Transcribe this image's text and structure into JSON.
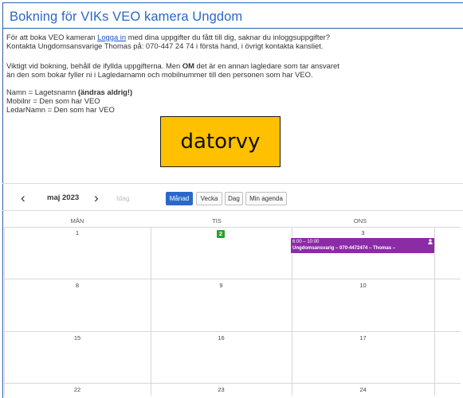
{
  "page": {
    "title": "Bokning för VIKs VEO kamera Ungdom",
    "intro_before_link": "För att boka VEO kameran ",
    "login_link": "Logga in",
    "intro_after_link": " med dina uppgifter du fått till dig, saknar du inloggsuppgifter?",
    "contact_line": "Kontakta Ungdomsansvarige Thomas på: 070-447 24 74 i första hand, i övrigt kontakta kansliet.",
    "important_before": "Viktigt vid bokning, behåll de ifyllda uppgifterna. Men ",
    "important_bold": "OM",
    "important_after": " det är en annan lagledare som tar ansvaret",
    "important_line2": "än den som bokar fyller ni i Lagledarnamn och mobilnummer till den personen som har VEO.",
    "name_rule_prefix": "Namn = Lagetsnamn ",
    "name_rule_bold": "(ändras aldrig!)",
    "mobile_rule": "Mobilnr = Den som har VEO",
    "leader_rule": "LedarNamn = Den som har VEO",
    "overlay_label": "datorvy"
  },
  "calendar": {
    "month_label": "maj 2023",
    "prev_icon": "‹",
    "next_icon": "›",
    "today_label": "Idag",
    "views": {
      "month": "Månad",
      "week": "Vecka",
      "day": "Dag",
      "agenda": "Min agenda"
    },
    "active_view": "month",
    "weekdays": [
      "MÅN",
      "TIS",
      "ONS"
    ],
    "weeks": [
      [
        "1",
        "2",
        "3"
      ],
      [
        "8",
        "9",
        "10"
      ],
      [
        "15",
        "16",
        "17"
      ],
      [
        "22",
        "23",
        "24"
      ]
    ],
    "today_day": "2",
    "event": {
      "time": "6:00 – 10:00",
      "title": "Ungdomsansvarig – 070-4472474 – Thomas –",
      "color": "#8b2ba6"
    }
  },
  "colors": {
    "title": "#2a67c9",
    "link": "#1a52c5",
    "active_view": "#2a67c9",
    "today_badge": "#2ca02c",
    "overlay": "#ffc000"
  }
}
